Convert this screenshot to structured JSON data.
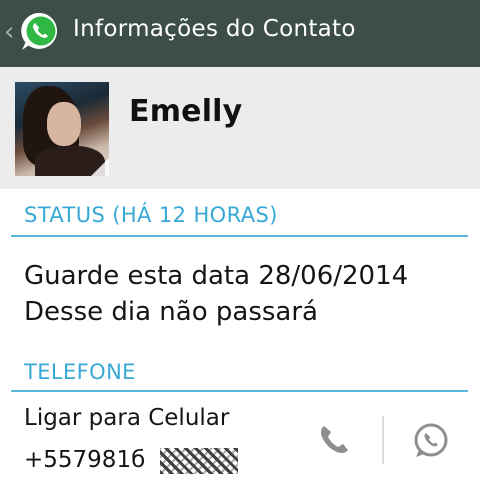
{
  "header": {
    "title": "Informações do Contato",
    "back_icon": "chevron-left-icon",
    "logo_icon": "whatsapp-logo-icon",
    "background": "#3c4d4a"
  },
  "contact": {
    "name": "Emelly",
    "avatar_icon": "profile-photo"
  },
  "status": {
    "header": "STATUS (HÁ 12 HORAS)",
    "line1": "Guarde esta data 28/06/2014",
    "line2": "Desse dia não passará"
  },
  "phone": {
    "header": "TELEFONE",
    "type_label": "Ligar para Celular",
    "number": "+557981б",
    "call_icon": "phone-icon",
    "message_icon": "whatsapp-chat-icon"
  },
  "colors": {
    "accent": "#38a9d6",
    "divider": "#5ab8de",
    "profile_bg": "#ececec"
  }
}
